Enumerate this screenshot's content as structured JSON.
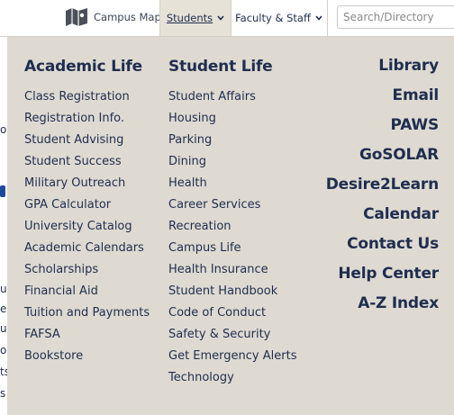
{
  "header": {
    "campus_map_label": "Campus Map",
    "students_label": "Students",
    "faculty_label": "Faculty & Staff",
    "search_placeholder": "Search/Directory"
  },
  "background_fragments": [
    "o",
    "u",
    "e",
    "u",
    "or",
    "ts",
    "s"
  ],
  "academic_life": {
    "title": "Academic Life",
    "items": [
      "Class Registration",
      "Registration Info.",
      "Student Advising",
      "Student Success",
      "Military Outreach",
      "GPA Calculator",
      "University Catalog",
      "Academic Calendars",
      "Scholarships",
      "Financial Aid",
      "Tuition and Payments",
      "FAFSA",
      "Bookstore"
    ]
  },
  "student_life": {
    "title": "Student Life",
    "items": [
      "Student Affairs",
      "Housing",
      "Parking",
      "Dining",
      "Health",
      "Career Services",
      "Recreation",
      "Campus Life",
      "Health Insurance",
      "Student Handbook",
      "Code of Conduct",
      "Safety & Security",
      "Get Emergency Alerts",
      "Technology"
    ]
  },
  "quick_links": [
    "Library",
    "Email",
    "PAWS",
    "GoSOLAR",
    "Desire2Learn",
    "Calendar",
    "Contact Us",
    "Help Center",
    "A-Z Index"
  ],
  "colors": {
    "menu_background": "#dedad1",
    "text": "#1f2d4f",
    "active_tab": "#e7e2d8"
  }
}
